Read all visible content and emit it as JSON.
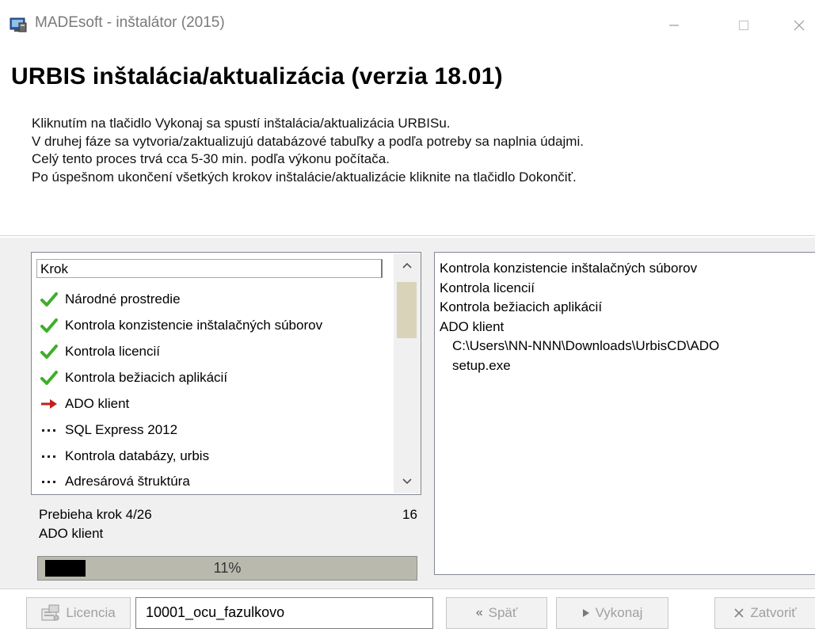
{
  "window": {
    "title": "MADEsoft - inštalátor (2015)"
  },
  "header": {
    "title": "URBIS inštalácia/aktualizácia (verzia 18.01)",
    "description": [
      "Kliknutím na tlačidlo Vykonaj sa spustí inštalácia/aktualizácia URBISu.",
      "V druhej fáze sa vytvoria/zaktualizujú databázové tabuľky a podľa potreby sa naplnia údajmi.",
      "Celý tento proces trvá cca 5-30 min. podľa výkonu počítača.",
      "Po úspešnom ukončení všetkých krokov inštalácie/aktualizácie kliknite na tlačidlo Dokončiť."
    ]
  },
  "steps": {
    "column_header": "Krok",
    "items": [
      {
        "label": "Národné prostredie",
        "state": "done",
        "icon": "check-icon"
      },
      {
        "label": "Kontrola konzistencie inštalačných súborov",
        "state": "done",
        "icon": "check-icon"
      },
      {
        "label": "Kontrola licencií",
        "state": "done",
        "icon": "check-icon"
      },
      {
        "label": "Kontrola bežiacich aplikácií",
        "state": "done",
        "icon": "check-icon"
      },
      {
        "label": "ADO klient",
        "state": "current",
        "icon": "arrow-right-icon"
      },
      {
        "label": "SQL Express 2012",
        "state": "pending",
        "icon": "ellipsis-icon"
      },
      {
        "label": "Kontrola databázy, urbis",
        "state": "pending",
        "icon": "ellipsis-icon"
      },
      {
        "label": "Adresárová štruktúra",
        "state": "pending",
        "icon": "ellipsis-icon"
      }
    ]
  },
  "status": {
    "step_text": "Prebieha krok 4/26",
    "counter": "16",
    "current_step": "ADO klient"
  },
  "progress": {
    "percent_label": "11%",
    "value": 0.11
  },
  "log": {
    "lines": [
      "Kontrola konzistencie inštalačných súborov",
      "Kontrola licencií",
      "Kontrola bežiacich aplikácií",
      "ADO klient",
      "  C:\\Users\\NN-NNN\\Downloads\\UrbisCD\\ADO",
      "  setup.exe"
    ]
  },
  "footer": {
    "license_label": "Licencia",
    "license_value": "10001_ocu_fazulkovo",
    "back_label": "Späť",
    "execute_label": "Vykonaj",
    "close_label": "Zatvoriť"
  },
  "colors": {
    "check": "#3fae2a",
    "arrow": "#c0211c",
    "progress_track": "#b9b9ae",
    "progress_fill": "#000000",
    "scroll_thumb": "#d9d4b9"
  }
}
